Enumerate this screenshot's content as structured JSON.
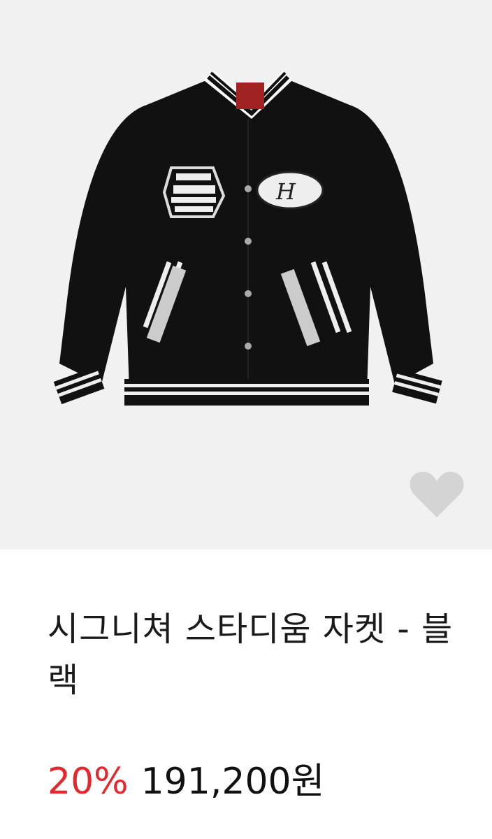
{
  "product": {
    "image_alt": "jacket-photo",
    "title": "시그니쳐 스타디움 자켓 - 블랙",
    "discount": "20%",
    "price": "191,200원",
    "wishlist_icon": "heart-icon",
    "colors": {
      "discount": "#e6262a",
      "background": "#f1f1f1",
      "heart": "#d4d4d4"
    }
  }
}
